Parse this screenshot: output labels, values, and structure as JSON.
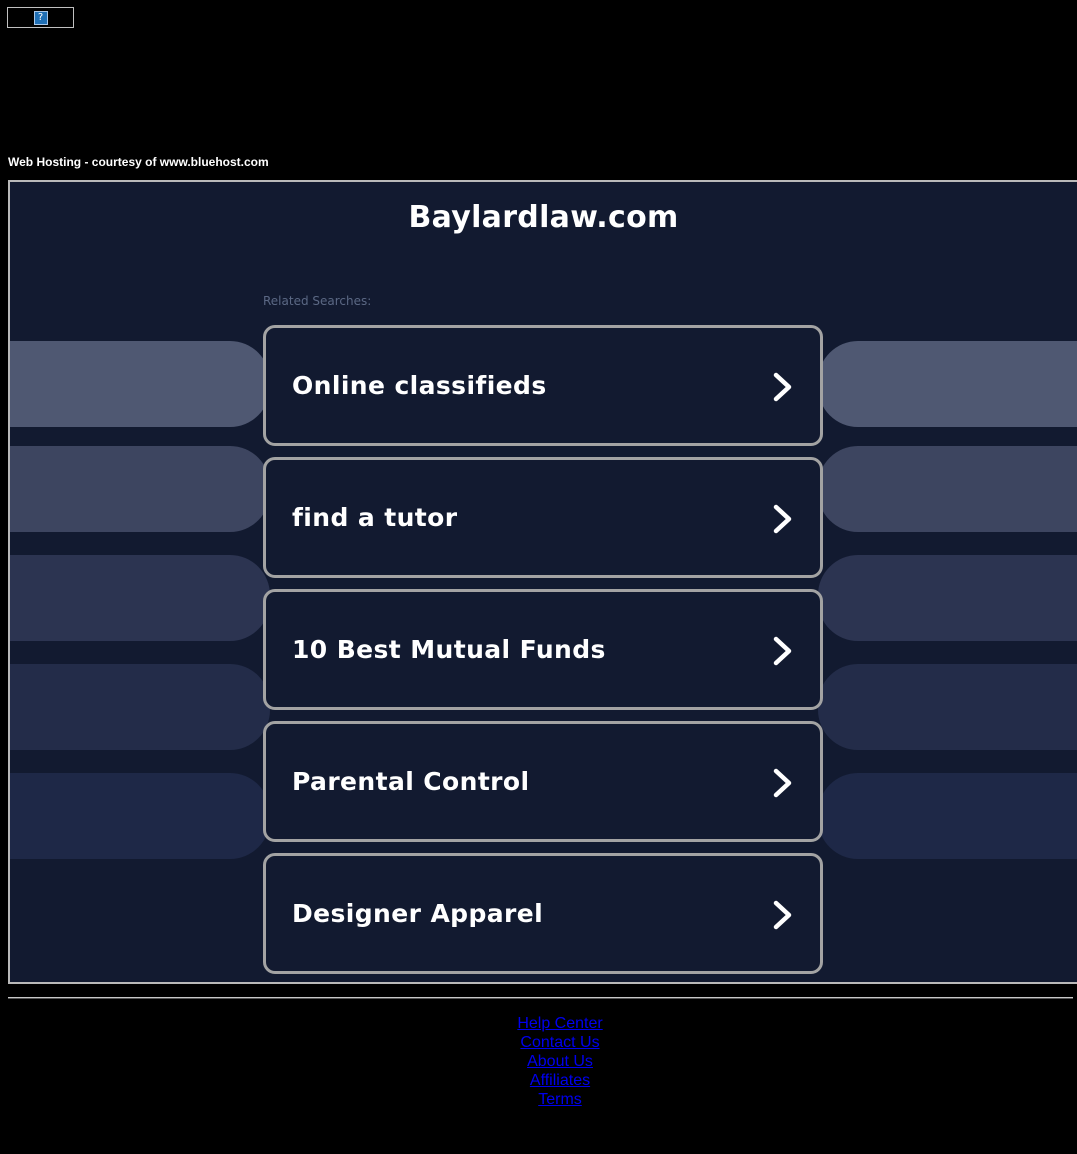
{
  "top_banner": {
    "icon": "broken-image-icon",
    "glyph": "?"
  },
  "hosting_note": "Web Hosting - courtesy of www.bluehost.com",
  "main": {
    "domain_title": "Baylardlaw.com",
    "related_label": "Related Searches:",
    "searches": [
      {
        "label": "Online classifieds",
        "icon": "chevron-right-icon"
      },
      {
        "label": "find a tutor",
        "icon": "chevron-right-icon"
      },
      {
        "label": "10 Best Mutual Funds",
        "icon": "chevron-right-icon"
      },
      {
        "label": "Parental Control",
        "icon": "chevron-right-icon"
      },
      {
        "label": "Designer Apparel",
        "icon": "chevron-right-icon"
      }
    ],
    "side_pill_colors": [
      "#4f5872",
      "#3d4560",
      "#2c3451",
      "#232c49",
      "#1e2847"
    ]
  },
  "footer": {
    "links": [
      "Help Center",
      "Contact Us",
      "About Us",
      "Affiliates",
      "Terms"
    ],
    "link_color": "#0000ee"
  },
  "colors": {
    "page_background": "#000000",
    "frame_background": "#121a30",
    "box_border": "#a3a3a3",
    "related_label": "#5b6884"
  }
}
